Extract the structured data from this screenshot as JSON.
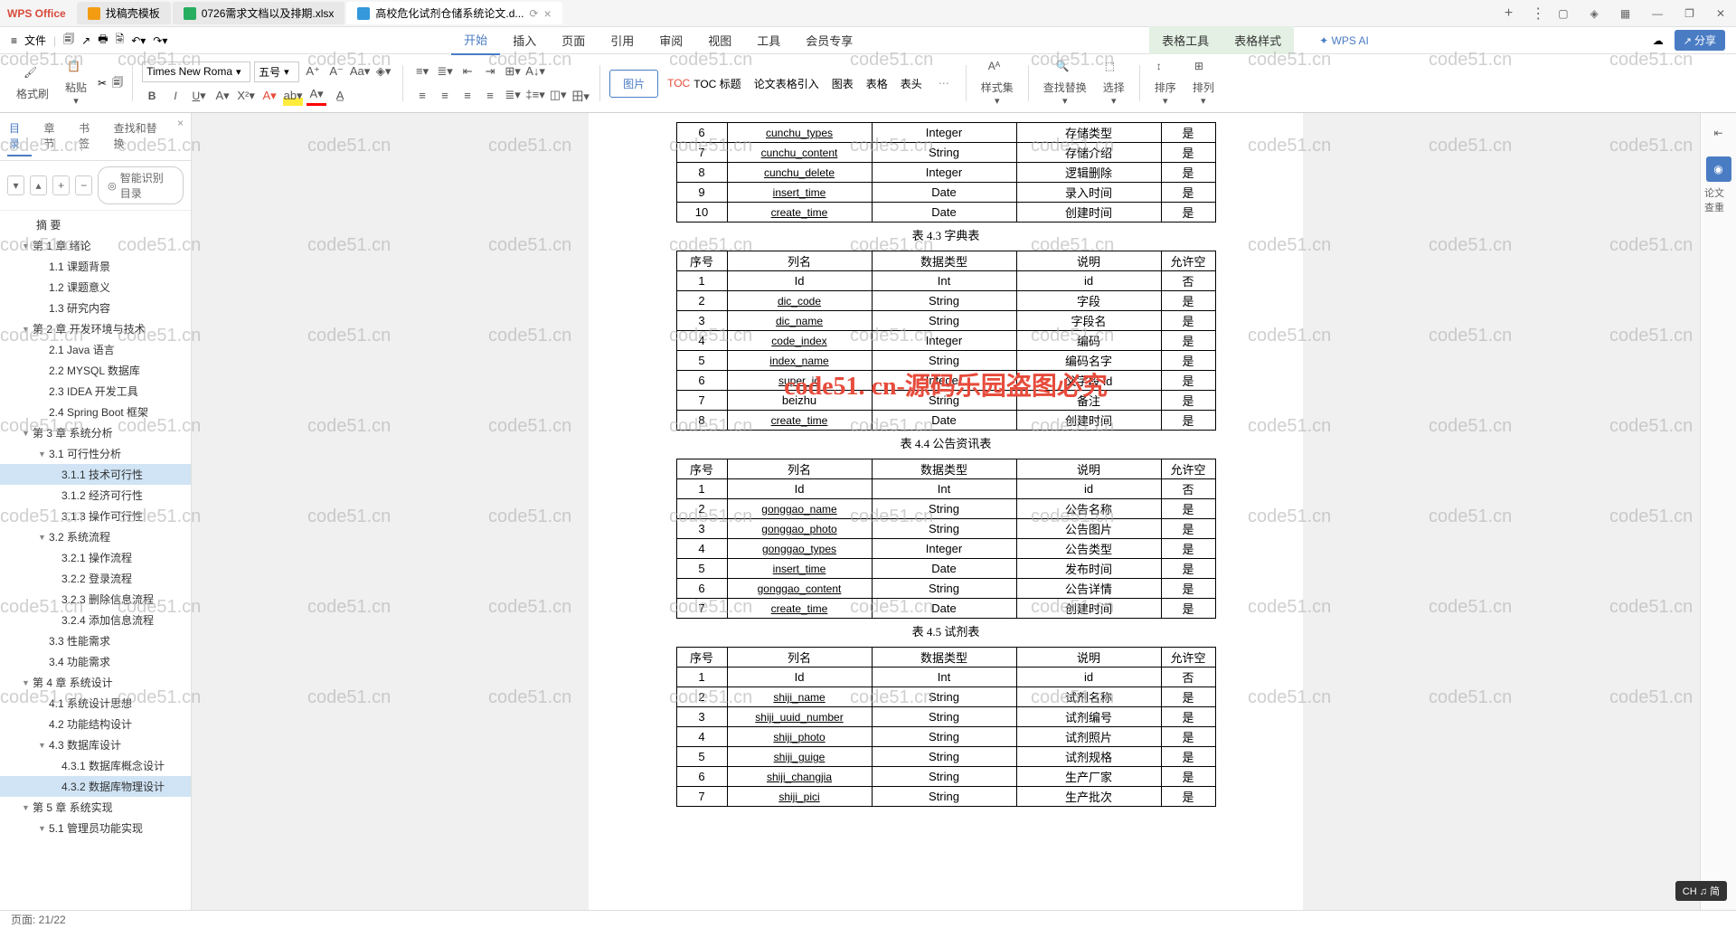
{
  "app_name": "WPS Office",
  "title_tabs": [
    {
      "label": "找稿壳模板",
      "icon": "orange"
    },
    {
      "label": "0726需求文档以及排期.xlsx",
      "icon": "green"
    },
    {
      "label": "高校危化试剂仓储系统论文.d...",
      "icon": "blue",
      "active": true
    }
  ],
  "file_menu": "文件",
  "ribbon_tabs": [
    "开始",
    "插入",
    "页面",
    "引用",
    "审阅",
    "视图",
    "工具",
    "会员专享"
  ],
  "context_tabs": [
    "表格工具",
    "表格样式"
  ],
  "wps_ai": "WPS AI",
  "share": "分享",
  "ribbon": {
    "format_painter": "格式刷",
    "paste": "粘贴",
    "font": "Times New Roma",
    "font_size": "五号",
    "img_btn": "图片",
    "toc": "TOC 标题",
    "ref": "论文表格引入",
    "chart": "图表",
    "table": "表格",
    "header": "表头",
    "style": "样式集",
    "find": "查找替换",
    "select": "选择",
    "sort": "排序",
    "arrange": "排列"
  },
  "nav": {
    "tabs": [
      "目录",
      "章节",
      "书签",
      "查找和替换"
    ],
    "smart": "智能识别目录",
    "items": [
      {
        "t": "摘 要",
        "lv": 0
      },
      {
        "t": "第 1 章 绪论",
        "lv": 1,
        "exp": true
      },
      {
        "t": "1.1 课题背景",
        "lv": 2
      },
      {
        "t": "1.2 课题意义",
        "lv": 2
      },
      {
        "t": "1.3 研究内容",
        "lv": 2
      },
      {
        "t": "第 2 章 开发环境与技术",
        "lv": 1,
        "exp": true
      },
      {
        "t": "2.1 Java 语言",
        "lv": 2
      },
      {
        "t": "2.2 MYSQL 数据库",
        "lv": 2
      },
      {
        "t": "2.3 IDEA 开发工具",
        "lv": 2
      },
      {
        "t": "2.4 Spring Boot 框架",
        "lv": 2
      },
      {
        "t": "第 3 章 系统分析",
        "lv": 1,
        "exp": true
      },
      {
        "t": "3.1 可行性分析",
        "lv": 2,
        "exp": true
      },
      {
        "t": "3.1.1 技术可行性",
        "lv": 3,
        "sel": true
      },
      {
        "t": "3.1.2 经济可行性",
        "lv": 3
      },
      {
        "t": "3.1.3 操作可行性",
        "lv": 3
      },
      {
        "t": "3.2 系统流程",
        "lv": 2,
        "exp": true
      },
      {
        "t": "3.2.1 操作流程",
        "lv": 3
      },
      {
        "t": "3.2.2 登录流程",
        "lv": 3
      },
      {
        "t": "3.2.3 删除信息流程",
        "lv": 3
      },
      {
        "t": "3.2.4 添加信息流程",
        "lv": 3
      },
      {
        "t": "3.3 性能需求",
        "lv": 2
      },
      {
        "t": "3.4 功能需求",
        "lv": 2
      },
      {
        "t": "第 4 章 系统设计",
        "lv": 1,
        "exp": true
      },
      {
        "t": "4.1 系统设计思想",
        "lv": 2
      },
      {
        "t": "4.2 功能结构设计",
        "lv": 2
      },
      {
        "t": "4.3 数据库设计",
        "lv": 2,
        "exp": true
      },
      {
        "t": "4.3.1 数据库概念设计",
        "lv": 3
      },
      {
        "t": "4.3.2 数据库物理设计",
        "lv": 3,
        "sel": true
      },
      {
        "t": "第 5 章 系统实现",
        "lv": 1,
        "exp": true
      },
      {
        "t": "5.1 管理员功能实现",
        "lv": 2,
        "exp": true
      }
    ]
  },
  "doc": {
    "table_top": [
      [
        "6",
        "cunchu_types",
        "Integer",
        "存储类型",
        "是"
      ],
      [
        "7",
        "cunchu_content",
        "String",
        "存储介绍",
        "是"
      ],
      [
        "8",
        "cunchu_delete",
        "Integer",
        "逻辑删除",
        "是"
      ],
      [
        "9",
        "insert_time",
        "Date",
        "录入时间",
        "是"
      ],
      [
        "10",
        "create_time",
        "Date",
        "创建时间",
        "是"
      ]
    ],
    "cap43": "表 4.3 字典表",
    "headers": [
      "序号",
      "列名",
      "数据类型",
      "说明",
      "允许空"
    ],
    "table43": [
      [
        "1",
        "Id",
        "Int",
        "id",
        "否"
      ],
      [
        "2",
        "dic_code",
        "String",
        "字段",
        "是"
      ],
      [
        "3",
        "dic_name",
        "String",
        "字段名",
        "是"
      ],
      [
        "4",
        "code_index",
        "Integer",
        "编码",
        "是"
      ],
      [
        "5",
        "index_name",
        "String",
        "编码名字",
        "是"
      ],
      [
        "6",
        "super_id",
        "Integer",
        "父字段 id",
        "是"
      ],
      [
        "7",
        "beizhu",
        "String",
        "备注",
        "是"
      ],
      [
        "8",
        "create_time",
        "Date",
        "创建时间",
        "是"
      ]
    ],
    "cap44": "表 4.4 公告资讯表",
    "table44": [
      [
        "1",
        "Id",
        "Int",
        "id",
        "否"
      ],
      [
        "2",
        "gonggao_name",
        "String",
        "公告名称",
        "是"
      ],
      [
        "3",
        "gonggao_photo",
        "String",
        "公告图片",
        "是"
      ],
      [
        "4",
        "gonggao_types",
        "Integer",
        "公告类型",
        "是"
      ],
      [
        "5",
        "insert_time",
        "Date",
        "发布时间",
        "是"
      ],
      [
        "6",
        "gonggao_content",
        "String",
        "公告详情",
        "是"
      ],
      [
        "7",
        "create_time",
        "Date",
        "创建时间",
        "是"
      ]
    ],
    "cap45": "表 4.5 试剂表",
    "table45": [
      [
        "1",
        "Id",
        "Int",
        "id",
        "否"
      ],
      [
        "2",
        "shiji_name",
        "String",
        "试剂名称",
        "是"
      ],
      [
        "3",
        "shiji_uuid_number",
        "String",
        "试剂编号",
        "是"
      ],
      [
        "4",
        "shiji_photo",
        "String",
        "试剂照片",
        "是"
      ],
      [
        "5",
        "shiji_guige",
        "String",
        "试剂规格",
        "是"
      ],
      [
        "6",
        "shiji_changjia",
        "String",
        "生产厂家",
        "是"
      ],
      [
        "7",
        "shiji_pici",
        "String",
        "生产批次",
        "是"
      ]
    ]
  },
  "red_overlay": "code51. cn-源码乐园盗图必究",
  "watermark": "code51.cn",
  "side": {
    "check": "论文查重"
  },
  "ime": "CH ♫ 简",
  "status": {
    "page": "页面: 21/22"
  }
}
